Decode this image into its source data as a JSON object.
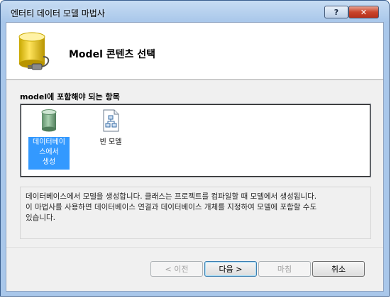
{
  "window": {
    "title": "엔터티 데이터 모델 마법사",
    "help_label": "?",
    "close_label": "✕"
  },
  "header": {
    "title": "Model 콘텐츠 선택",
    "icon": "database-plug-icon"
  },
  "content": {
    "section_label": "model에 포함해야 되는 항목",
    "items": [
      {
        "label_line1": "데이터베이",
        "label_line2": "스에서",
        "label_line3": "생성",
        "icon": "database-icon",
        "selected": true
      },
      {
        "label_line1": "빈 모델",
        "icon": "empty-model-icon",
        "selected": false
      }
    ],
    "description": {
      "line1": "데이터베이스에서 모델을 생성합니다. 클래스는 프로젝트를 컴파일할 때 모델에서 생성됩니다.",
      "line2": "이 마법사를 사용하면 데이터베이스 연결과 데이터베이스 개체를 지정하여 모델에 포함할 수도",
      "line3": "있습니다."
    }
  },
  "buttons": {
    "prev": "< 이전",
    "next": "다음 >",
    "finish": "마침",
    "cancel": "취소"
  },
  "colors": {
    "selection": "#3399ff",
    "titlebar": "#a9c7ea",
    "close": "#c9452c"
  }
}
